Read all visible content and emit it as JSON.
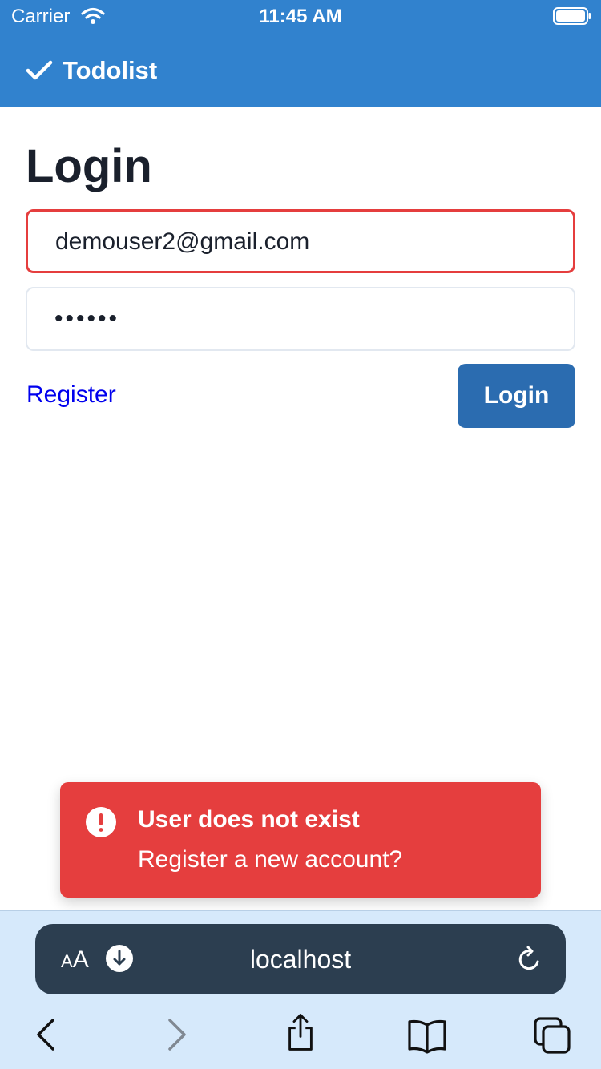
{
  "status_bar": {
    "carrier": "Carrier",
    "time": "11:45 AM"
  },
  "app": {
    "title": "Todolist"
  },
  "login": {
    "title": "Login",
    "email_value": "demouser2@gmail.com",
    "password_value": "••••••",
    "register_label": "Register",
    "login_label": "Login"
  },
  "toast": {
    "title": "User does not exist",
    "description": "Register a new account?"
  },
  "browser": {
    "aa_small": "A",
    "aa_large": "A",
    "url": "localhost"
  },
  "colors": {
    "header_blue": "#3182ce",
    "button_blue": "#2b6cb0",
    "error_red": "#e53e3e",
    "browser_bar": "#d6e9fb",
    "url_pill": "#2c3e50"
  }
}
